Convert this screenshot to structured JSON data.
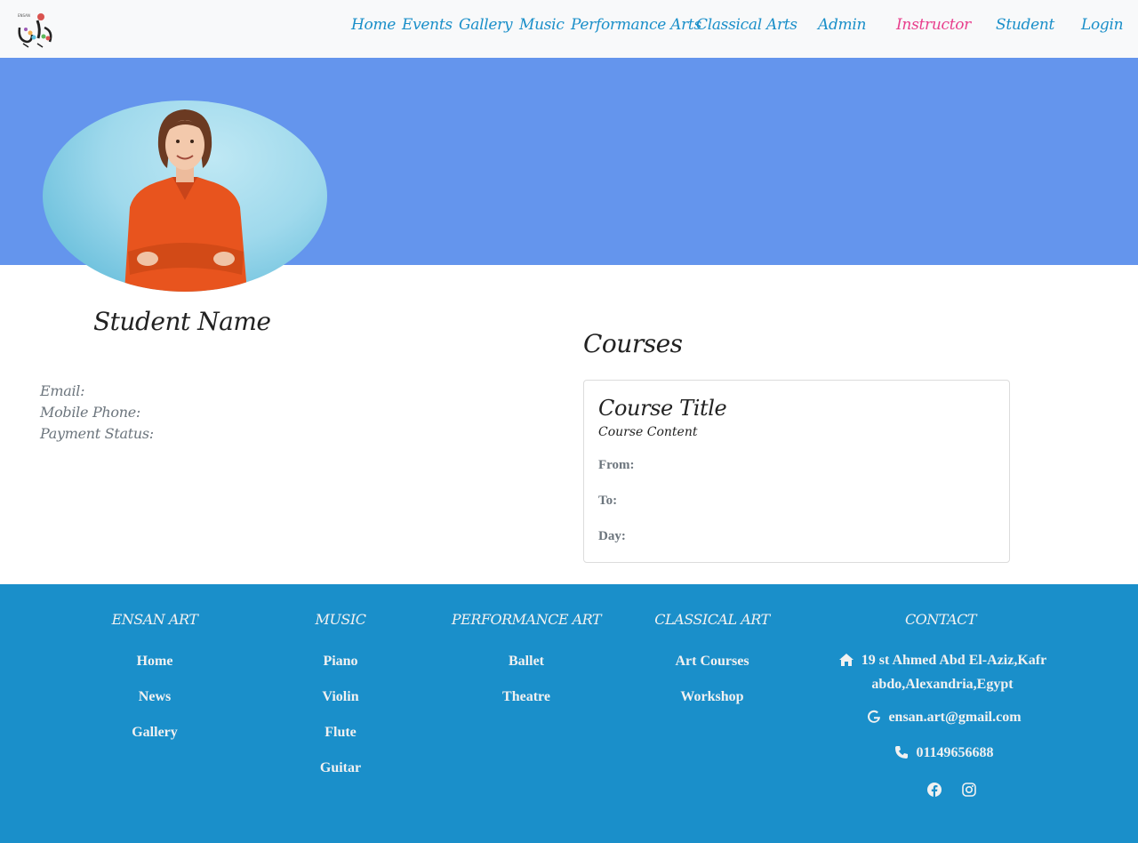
{
  "nav": {
    "items": [
      {
        "label": "Home",
        "active": false
      },
      {
        "label": "Events",
        "active": false
      },
      {
        "label": "Gallery",
        "active": false
      },
      {
        "label": "Music",
        "active": false
      },
      {
        "label": "Performance Arts",
        "active": false
      },
      {
        "label": "Classical Arts",
        "active": false
      },
      {
        "label": "Admin",
        "active": false
      },
      {
        "label": "Instructor",
        "active": true
      },
      {
        "label": "Student",
        "active": false
      },
      {
        "label": "Login",
        "active": false
      }
    ]
  },
  "profile": {
    "name": "Student Name",
    "email_label": "Email:",
    "phone_label": "Mobile Phone:",
    "payment_label": "Payment Status:"
  },
  "courses": {
    "title": "Courses",
    "card": {
      "title": "Course Title",
      "content": "Course Content",
      "from_label": "From:",
      "to_label": "To:",
      "day_label": "Day:"
    }
  },
  "footer": {
    "ensan": {
      "title": "ENSAN ART",
      "links": [
        "Home",
        "News",
        "Gallery"
      ]
    },
    "music": {
      "title": "MUSIC",
      "links": [
        "Piano",
        "Violin",
        "Flute",
        "Guitar"
      ]
    },
    "performance": {
      "title": "PERFORMANCE ART",
      "links": [
        "Ballet",
        "Theatre"
      ]
    },
    "classical": {
      "title": "CLASSICAL ART",
      "links": [
        "Art Courses",
        "Workshop"
      ]
    },
    "contact": {
      "title": "CONTACT",
      "address_line1": "19 st Ahmed Abd El-Aziz,Kafr",
      "address_line2": "abdo,Alexandria,Egypt",
      "email": "ensan.art@gmail.com",
      "phone": "01149656688"
    }
  },
  "colors": {
    "nav_link": "#1a8fc9",
    "nav_active": "#e83e8c",
    "hero": "#6495ed",
    "footer": "#1a8fca"
  },
  "icons": [
    "home-icon",
    "google-icon",
    "phone-icon",
    "facebook-icon",
    "instagram-icon"
  ]
}
